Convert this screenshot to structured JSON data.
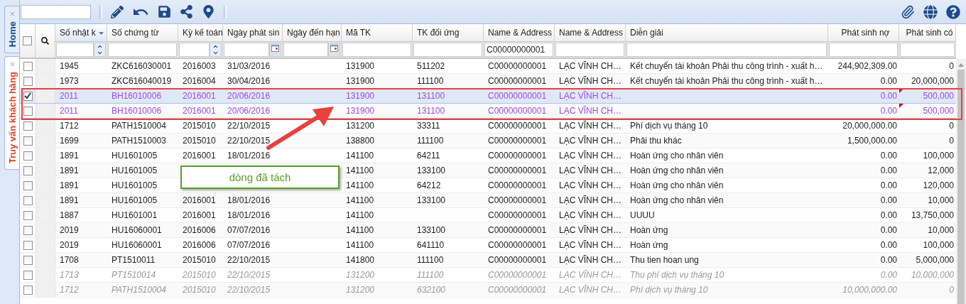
{
  "side_tabs": [
    {
      "label": "Home",
      "selected": false
    },
    {
      "label": "Truy vấn khách hàng",
      "selected": true
    }
  ],
  "table": {
    "select_all": {
      "checked": false
    },
    "columns": [
      {
        "label": "Số nhật k",
        "sorted": true,
        "filter_spinner": true,
        "filter_calendar": false,
        "numeric": false
      },
      {
        "label": "Số chứng từ",
        "sorted": false,
        "filter_spinner": false,
        "filter_calendar": false,
        "numeric": false
      },
      {
        "label": "Kỳ kế toán",
        "sorted": false,
        "filter_spinner": true,
        "filter_calendar": false,
        "numeric": false
      },
      {
        "label": "Ngày phát sin",
        "sorted": false,
        "filter_spinner": false,
        "filter_calendar": true,
        "numeric": false
      },
      {
        "label": "Ngày đến hạn",
        "sorted": false,
        "filter_spinner": false,
        "filter_calendar": true,
        "numeric": false
      },
      {
        "label": "Mã TK",
        "sorted": false,
        "filter_spinner": false,
        "filter_calendar": false,
        "numeric": false
      },
      {
        "label": "TK đối ứng",
        "sorted": false,
        "filter_spinner": false,
        "filter_calendar": false,
        "numeric": false
      },
      {
        "label": "Name & Address",
        "sorted": false,
        "filter_spinner": false,
        "filter_calendar": false,
        "filter_value": "C00000000001",
        "numeric": false
      },
      {
        "label": "Name & Address",
        "sorted": false,
        "filter_spinner": false,
        "filter_calendar": false,
        "numeric": false
      },
      {
        "label": "Diễn giải",
        "sorted": false,
        "filter_spinner": false,
        "filter_calendar": false,
        "numeric": false
      },
      {
        "label": "Phát sinh nợ",
        "sorted": false,
        "filter_spinner": false,
        "filter_calendar": false,
        "numeric": true
      },
      {
        "label": "Phát sinh có",
        "sorted": false,
        "filter_spinner": false,
        "filter_calendar": false,
        "numeric": true
      }
    ],
    "rows": [
      {
        "kind": "normal",
        "checked": false,
        "selected": false,
        "cells": [
          "1945",
          "ZKC616030001",
          "2016003",
          "31/03/2016",
          null,
          "131900",
          "511202",
          "C00000000001",
          "LẠC VĨNH CH…",
          "Kết chuyển tài khoản Phải thu công trình - xuất h…",
          "244,902,309.00",
          "0"
        ]
      },
      {
        "kind": "normal",
        "checked": false,
        "selected": false,
        "cells": [
          "1973",
          "ZKC616040019",
          "2016004",
          "30/04/2016",
          null,
          "131900",
          "111100",
          "C00000000001",
          "LẠC VĨNH CH…",
          "Kết chuyển tài khoản Phải thu công trình - xuất h…",
          "0.00",
          "20,000,000"
        ]
      },
      {
        "kind": "split",
        "checked": true,
        "selected": true,
        "cells": [
          "2011",
          "BH16010006",
          "2016001",
          "20/06/2016",
          null,
          "131900",
          "131100",
          "C00000000001",
          "LẠC VĨNH CH…",
          null,
          "0.00",
          "500,000"
        ]
      },
      {
        "kind": "split",
        "checked": false,
        "selected": false,
        "cells": [
          "2011",
          "BH16010006",
          "2016001",
          "20/06/2016",
          null,
          "131900",
          "131100",
          "C00000000001",
          "LẠC VĨNH CH…",
          null,
          "0.00",
          "500,000"
        ]
      },
      {
        "kind": "normal",
        "checked": false,
        "selected": false,
        "cells": [
          "1712",
          "PATH1510004",
          "2015010",
          "22/10/2015",
          null,
          "131200",
          "33311",
          "C00000000001",
          "LẠC VĨNH CH…",
          "Phí dịch vụ tháng 10",
          "20,000,000.00",
          "0"
        ]
      },
      {
        "kind": "normal",
        "checked": false,
        "selected": false,
        "cells": [
          "1699",
          "PATH1510003",
          "2015010",
          "22/10/2015",
          null,
          "138800",
          "111100",
          "C00000000001",
          "LẠC VĨNH CH…",
          "Phải thu khác",
          "1,500,000.00",
          "0"
        ]
      },
      {
        "kind": "normal",
        "checked": false,
        "selected": false,
        "cells": [
          "1891",
          "HU1601005",
          "2016001",
          "18/01/2016",
          null,
          "141100",
          "64211",
          "C00000000001",
          "LẠC VĨNH CH…",
          "Hoàn ứng cho nhân viên",
          "0.00",
          "100,000"
        ]
      },
      {
        "kind": "normal",
        "checked": false,
        "selected": false,
        "cells": [
          "1891",
          "HU1601005",
          null,
          null,
          null,
          "141100",
          "133100",
          "C00000000001",
          "LẠC VĨNH CH…",
          "Hoàn ứng cho nhân viên",
          "0.00",
          "12,000"
        ]
      },
      {
        "kind": "normal",
        "checked": false,
        "selected": false,
        "cells": [
          "1891",
          "HU1601005",
          null,
          null,
          null,
          "141100",
          "64212",
          "C00000000001",
          "LẠC VĨNH CH…",
          "Hoàn ứng cho nhân viên",
          "0.00",
          "120,000"
        ]
      },
      {
        "kind": "normal",
        "checked": false,
        "selected": false,
        "cells": [
          "1891",
          "HU1601005",
          "2016001",
          "18/01/2016",
          null,
          "141100",
          "133100",
          "C00000000001",
          "LẠC VĨNH CH…",
          "Hoàn ứng cho nhân viên",
          "0.00",
          "10,000"
        ]
      },
      {
        "kind": "normal",
        "checked": false,
        "selected": false,
        "cells": [
          "1887",
          "HU1601001",
          "2016001",
          "18/01/2016",
          null,
          "141100",
          null,
          "C00000000001",
          "LẠC VĨNH CH…",
          "UUUU",
          "0.00",
          "13,750,000"
        ]
      },
      {
        "kind": "normal",
        "checked": false,
        "selected": false,
        "cells": [
          "2019",
          "HU16060001",
          "2016006",
          "07/07/2016",
          null,
          "141100",
          "133100",
          "C00000000001",
          "LẠC VĨNH CH…",
          "Hoàn ứng",
          "0.00",
          "10,000"
        ]
      },
      {
        "kind": "normal",
        "checked": false,
        "selected": false,
        "cells": [
          "2019",
          "HU16060001",
          "2016006",
          "07/07/2016",
          null,
          "141100",
          "641110",
          "C00000000001",
          "LẠC VĨNH CH…",
          "Hoàn ứng",
          "0.00",
          "100,000"
        ]
      },
      {
        "kind": "normal",
        "checked": false,
        "selected": false,
        "cells": [
          "1708",
          "PT1510011",
          "2015010",
          "22/10/2015",
          null,
          "141800",
          "111100",
          "C00000000001",
          "LẠC VĨNH CH…",
          "Thu tien hoan ung",
          "0.00",
          "5,000,000"
        ]
      },
      {
        "kind": "draft",
        "checked": false,
        "selected": false,
        "cells": [
          "1713",
          "PT1510014",
          "2015010",
          "22/10/2015",
          null,
          "131200",
          "111100",
          "C00000000001",
          "LẠC VĨNH CH…",
          "Thu phí dịch vụ tháng 10",
          "0.00",
          "10,000,000"
        ]
      },
      {
        "kind": "draft",
        "checked": false,
        "selected": false,
        "cells": [
          "1712",
          "PATH1510004",
          "2015010",
          "22/10/2015",
          null,
          "131200",
          "632100",
          "C00000000001",
          "LẠC VĨNH CH…",
          "Phí dịch vụ tháng 10",
          "10,000,000.00",
          "0"
        ]
      }
    ]
  },
  "annotation": {
    "callout": "dòng đã tách"
  }
}
